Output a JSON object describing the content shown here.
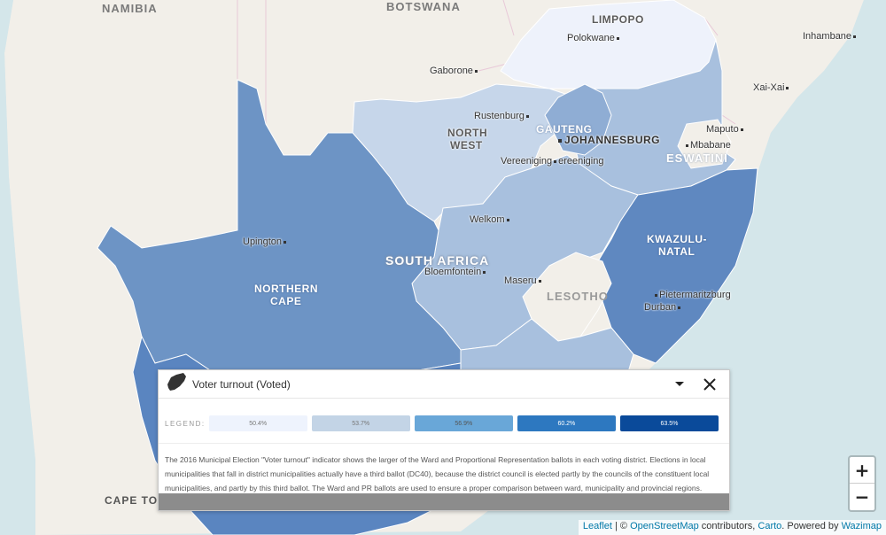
{
  "map": {
    "countries": [
      "NAMIBIA",
      "BOTSWANA",
      "ESWATINI",
      "LESOTHO",
      "SOUTH AFRICA"
    ],
    "provinces": {
      "limpopo": "LIMPOPO",
      "north_west_1": "NORTH",
      "north_west_2": "WEST",
      "gauteng": "GAUTENG",
      "kzn_1": "KWAZULU-",
      "kzn_2": "NATAL",
      "nc_1": "NORTHERN",
      "nc_2": "CAPE"
    },
    "cities": {
      "polokwane": "Polokwane",
      "inhambane": "Inhambane",
      "xai_xai": "Xai-Xai",
      "gaborone": "Gaborone",
      "rustenburg": "Rustenburg",
      "maputo": "Maputo",
      "mbabane": "Mbabane",
      "vereeniging1": "Vereeniging",
      "vereeniging2": "ereeniging",
      "welkom": "Welkom",
      "upington": "Upington",
      "bloemfontein": "Bloemfontein",
      "maseru": "Maseru",
      "pietermaritzburg": "Pietermaritzburg",
      "durban": "Durban",
      "cape_town": "CAPE TOW"
    },
    "johannesburg": "JOHANNESBURG",
    "colors": {
      "water": "#d4e6ea",
      "land": "#f2efe9",
      "limpopo": "#eef2fb",
      "north_west": "#c6d6ea",
      "free_state": "#a8c0de",
      "mpumalanga": "#a8c0de",
      "gauteng": "#8fadd4",
      "northern_cape": "#6d94c5",
      "kzn": "#5f88c0",
      "western_cape": "#5a85c0"
    }
  },
  "panel": {
    "title": "Voter turnout (Voted)",
    "icon": "south-africa-map-icon",
    "legend_label": "LEGEND:",
    "legend": [
      {
        "value": "50.4%",
        "color": "#eef3fd",
        "text": "#777"
      },
      {
        "value": "53.7%",
        "color": "#c3d4e6",
        "text": "#777"
      },
      {
        "value": "56.9%",
        "color": "#69a7d8",
        "text": "#555"
      },
      {
        "value": "60.2%",
        "color": "#2d78c0",
        "text": "#fff"
      },
      {
        "value": "63.5%",
        "color": "#0a4a9a",
        "text": "#fff"
      }
    ],
    "description": "The 2016 Municipal Election \"Voter turnout\" indicator shows the larger of the Ward and Proportional Representation ballots in each voting district. Elections in local municipalities that fall in district municipalities actually have a third ballot (DC40), because the district council is elected partly by the councils of the constituent local municipalities, and partly by this third ballot. The Ward and PR ballots are used to ensure a proper comparison between ward, municipality and provincial regions."
  },
  "zoom": {
    "in": "+",
    "out": "−"
  },
  "attribution": {
    "leaflet": "Leaflet",
    "sep": " | © ",
    "osm": "OpenStreetMap",
    "contrib": " contributors, ",
    "carto": "Carto",
    "powered": ". Powered by ",
    "wazimap": "Wazimap"
  }
}
